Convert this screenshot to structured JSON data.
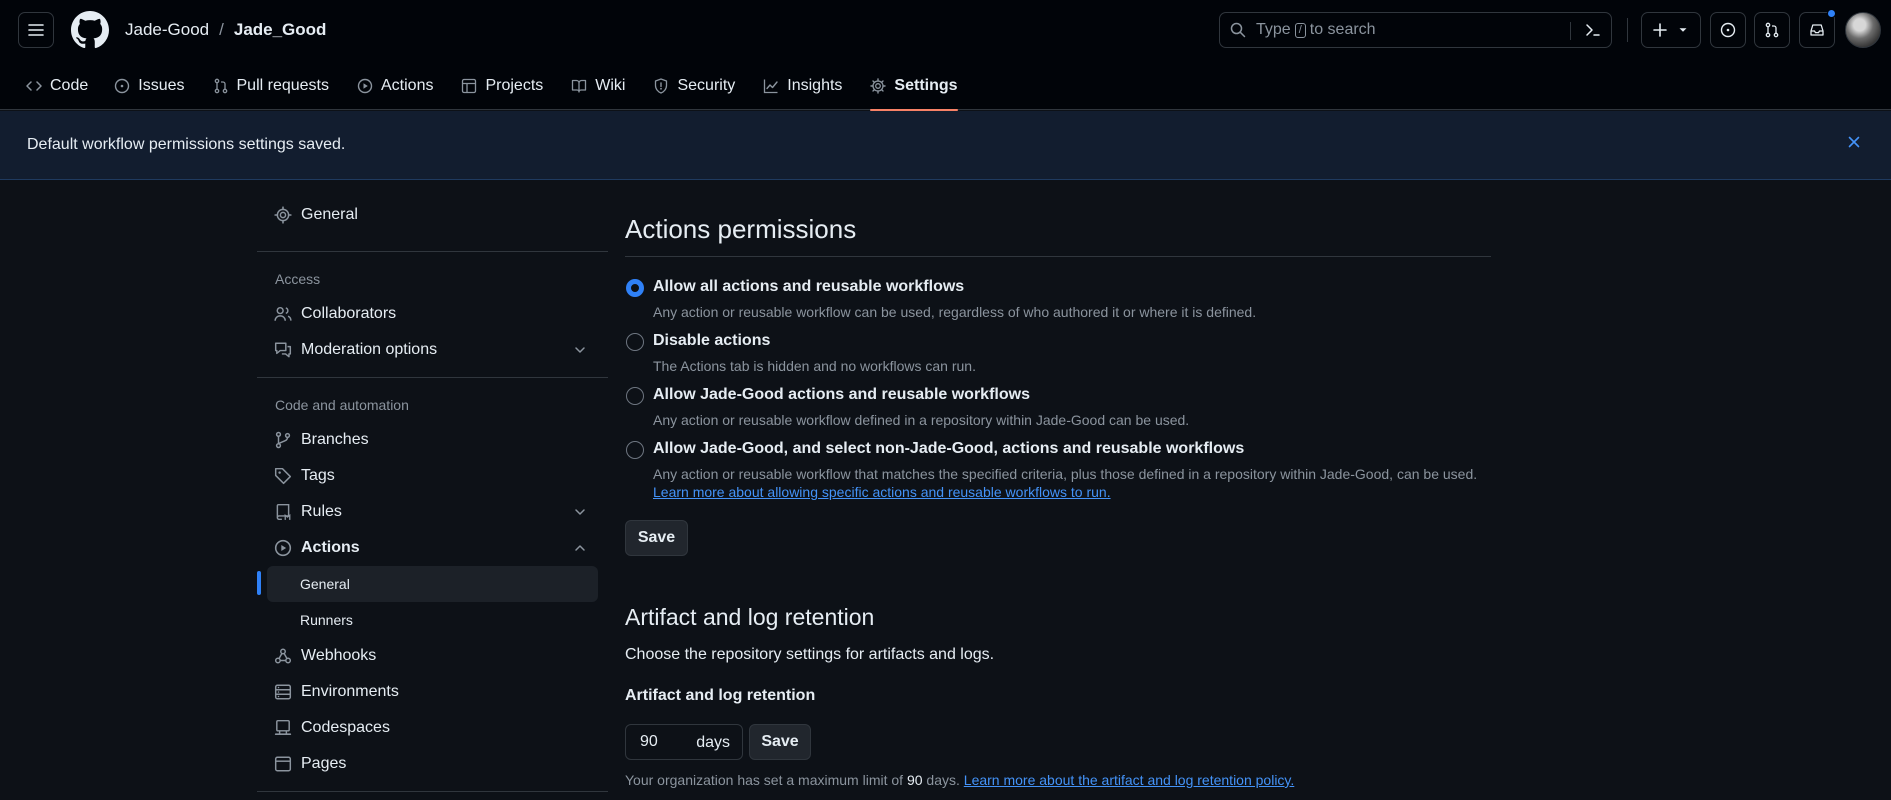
{
  "header": {
    "owner": "Jade-Good",
    "separator": "/",
    "repo": "Jade_Good",
    "search_placeholder_prefix": "Type",
    "search_key": "/",
    "search_placeholder_suffix": "to search"
  },
  "tabs": [
    {
      "label": "Code",
      "icon": "code-icon"
    },
    {
      "label": "Issues",
      "icon": "issue-opened-icon"
    },
    {
      "label": "Pull requests",
      "icon": "pull-request-icon"
    },
    {
      "label": "Actions",
      "icon": "play-icon"
    },
    {
      "label": "Projects",
      "icon": "table-icon"
    },
    {
      "label": "Wiki",
      "icon": "book-icon"
    },
    {
      "label": "Security",
      "icon": "shield-icon"
    },
    {
      "label": "Insights",
      "icon": "graph-icon"
    },
    {
      "label": "Settings",
      "icon": "gear-icon",
      "selected": true
    }
  ],
  "flash": {
    "message": "Default workflow permissions settings saved."
  },
  "sidebar": {
    "general": "General",
    "access_heading": "Access",
    "collaborators": "Collaborators",
    "moderation": "Moderation options",
    "code_heading": "Code and automation",
    "branches": "Branches",
    "tags": "Tags",
    "rules": "Rules",
    "actions": "Actions",
    "actions_general": "General",
    "actions_runners": "Runners",
    "webhooks": "Webhooks",
    "environments": "Environments",
    "codespaces": "Codespaces",
    "pages": "Pages"
  },
  "permissions": {
    "title": "Actions permissions",
    "options": [
      {
        "label": "Allow all actions and reusable workflows",
        "note": "Any action or reusable workflow can be used, regardless of who authored it or where it is defined.",
        "checked": true
      },
      {
        "label": "Disable actions",
        "note": "The Actions tab is hidden and no workflows can run.",
        "checked": false
      },
      {
        "label": "Allow Jade-Good actions and reusable workflows",
        "note": "Any action or reusable workflow defined in a repository within Jade-Good can be used.",
        "checked": false
      },
      {
        "label": "Allow Jade-Good, and select non-Jade-Good, actions and reusable workflows",
        "note": "Any action or reusable workflow that matches the specified criteria, plus those defined in a repository within Jade-Good, can be used.",
        "link": "Learn more about allowing specific actions and reusable workflows to run.",
        "checked": false
      }
    ],
    "save_label": "Save"
  },
  "retention": {
    "title": "Artifact and log retention",
    "description": "Choose the repository settings for artifacts and logs.",
    "field_label": "Artifact and log retention",
    "days_value": "90",
    "days_unit": "days",
    "save_label": "Save",
    "note_prefix": "Your organization has set a maximum limit of",
    "note_limit": "90",
    "note_unit": "days.",
    "note_link": "Learn more about the artifact and log retention policy."
  }
}
